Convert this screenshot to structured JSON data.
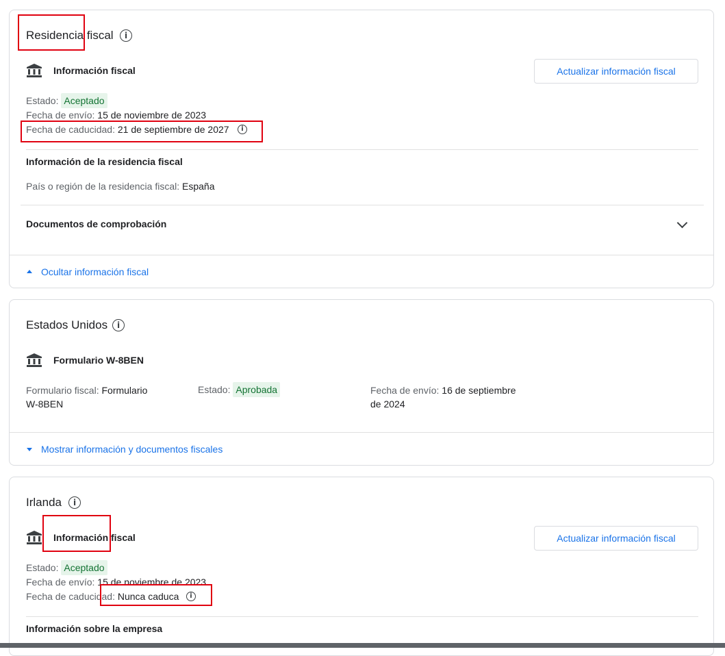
{
  "residencia": {
    "title": "Residencia fiscal",
    "subtitle": "Información fiscal",
    "button": "Actualizar información fiscal",
    "estado_label": "Estado:",
    "estado_value": "Aceptado",
    "envio_label": "Fecha de envío:",
    "envio_value": "15 de noviembre de 2023",
    "caducidad_label": "Fecha de caducidad:",
    "caducidad_value": "21 de septiembre de 2027",
    "section_title": "Información de la residencia fiscal",
    "pais_label": "País o región de la residencia fiscal:",
    "pais_value": "España",
    "docs_title": "Documentos de comprobación",
    "toggle_link": "Ocultar información fiscal"
  },
  "usa": {
    "title": "Estados Unidos",
    "subtitle": "Formulario W-8BEN",
    "form_label": "Formulario fiscal:",
    "form_value_1": "Formulario",
    "form_value_2": "W-8BEN",
    "estado_label": "Estado:",
    "estado_value": "Aprobada",
    "envio_label": "Fecha de envío:",
    "envio_value_1": "16 de septiembre",
    "envio_value_2": "de 2024",
    "toggle_link": "Mostrar información y documentos fiscales"
  },
  "irlanda": {
    "title": "Irlanda",
    "subtitle": "Información fiscal",
    "button": "Actualizar información fiscal",
    "estado_label": "Estado:",
    "estado_value": "Aceptado",
    "envio_label": "Fecha de envío:",
    "envio_value": "15 de noviembre de 2023",
    "caducidad_label": "Fecha de caducidad:",
    "caducidad_value": "Nunca caduca",
    "section_title": "Información sobre la empresa"
  },
  "colors": {
    "accent": "#1a73e8",
    "badge_bg": "#e6f4ea",
    "badge_text": "#137333",
    "highlight": "#e0000f"
  },
  "icons": [
    "info-icon",
    "bank-icon",
    "chevron-down-icon",
    "caret-up-icon",
    "caret-down-icon"
  ]
}
